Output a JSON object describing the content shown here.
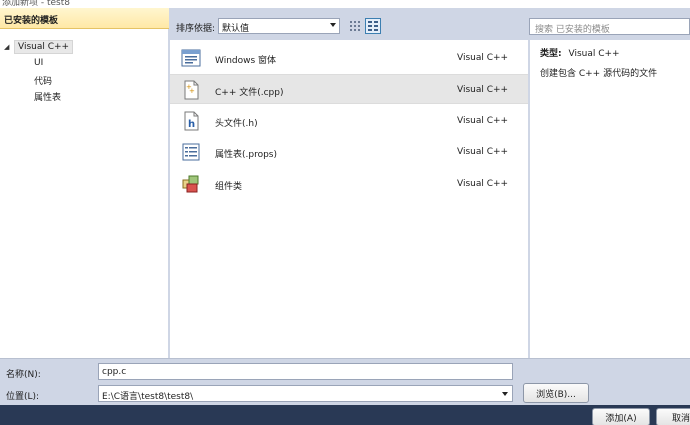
{
  "window": {
    "title": "添加新项 - test8"
  },
  "left_panel": {
    "header": "已安装的模板",
    "tree_root": "Visual C++",
    "children": [
      "UI",
      "代码",
      "属性表"
    ]
  },
  "toolbar": {
    "sort_label": "排序依据:",
    "sort_value": "默认值"
  },
  "templates": [
    {
      "name": "Windows 窗体",
      "type": "Visual C++",
      "icon": "form-icon",
      "selected": false
    },
    {
      "name": "C++ 文件(.cpp)",
      "type": "Visual C++",
      "icon": "cpp-file-icon",
      "selected": true
    },
    {
      "name": "头文件(.h)",
      "type": "Visual C++",
      "icon": "header-file-icon",
      "selected": false
    },
    {
      "name": "属性表(.props)",
      "type": "Visual C++",
      "icon": "property-sheet-icon",
      "selected": false
    },
    {
      "name": "组件类",
      "type": "Visual C++",
      "icon": "component-class-icon",
      "selected": false
    }
  ],
  "search": {
    "placeholder": "搜索 已安装的模板"
  },
  "details": {
    "type_label": "类型:",
    "type_value": "Visual C++",
    "description": "创建包含 C++ 源代码的文件"
  },
  "form": {
    "name_label": "名称(N):",
    "name_value": "cpp.c",
    "location_label": "位置(L):",
    "location_value": "E:\\C语言\\test8\\test8\\",
    "browse_button": "浏览(B)...",
    "add_button": "添加(A)",
    "cancel_button": "取消"
  },
  "colors": {
    "background": "#cfd6e5",
    "header_highlight": "#ffe8a6",
    "footer": "#293955"
  }
}
